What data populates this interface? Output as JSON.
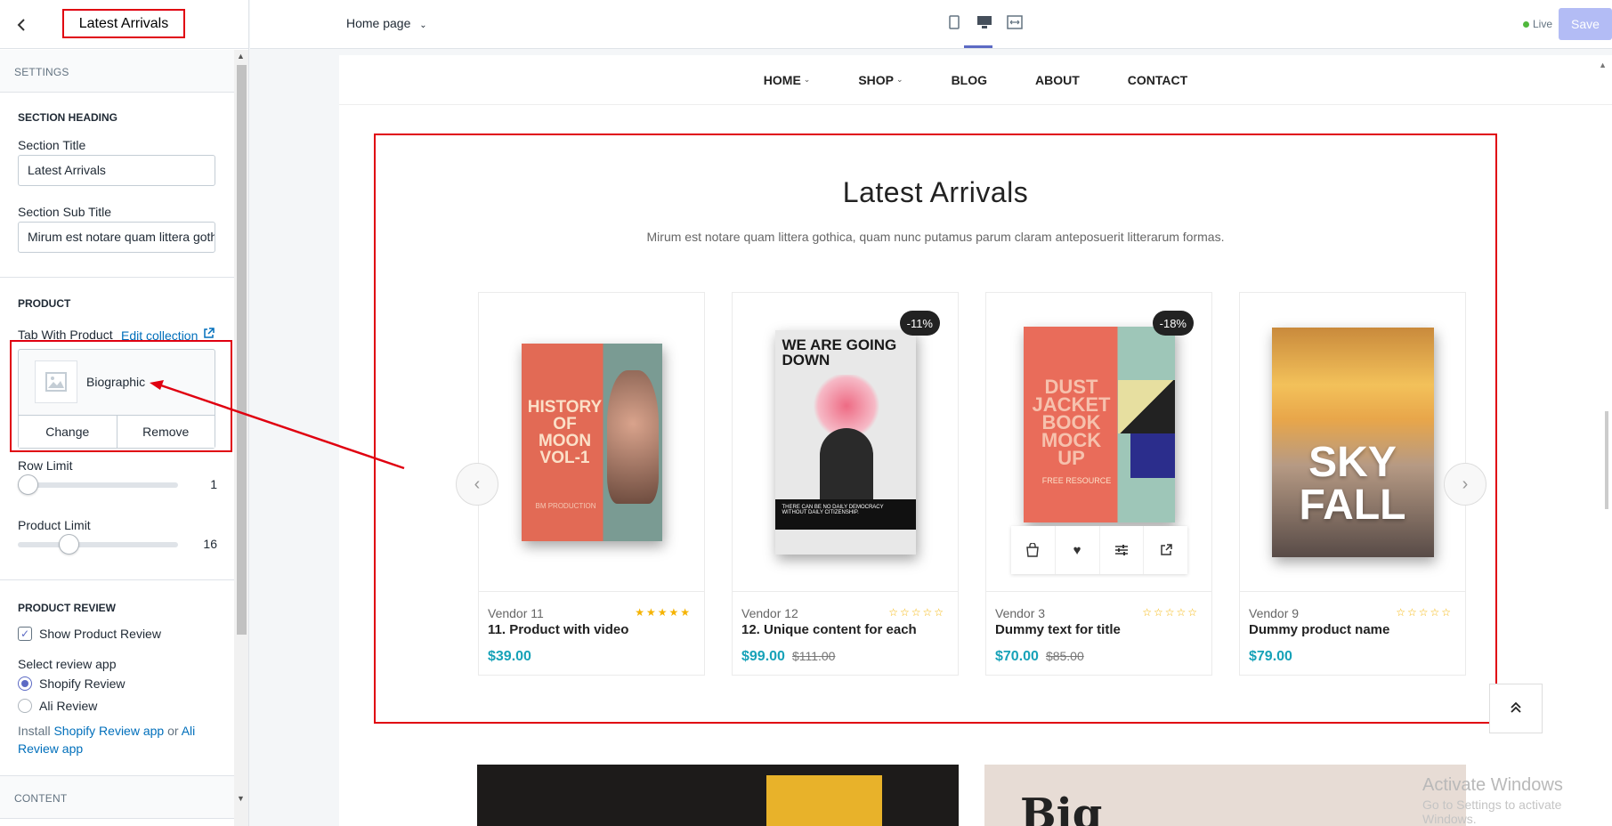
{
  "sidebar": {
    "title": "Latest Arrivals",
    "settings_label": "SETTINGS",
    "section_heading": {
      "heading": "SECTION HEADING",
      "title_label": "Section Title",
      "title_value": "Latest Arrivals",
      "subtitle_label": "Section Sub Title",
      "subtitle_value": "Mirum est notare quam littera gothica"
    },
    "product": {
      "heading": "PRODUCT",
      "tab_label": "Tab With Product",
      "edit_link": "Edit collection",
      "selected_collection": "Biographic",
      "change_label": "Change",
      "remove_label": "Remove",
      "row_limit_label": "Row Limit",
      "row_limit_value": "1",
      "product_limit_label": "Product Limit",
      "product_limit_value": "16"
    },
    "review": {
      "heading": "PRODUCT REVIEW",
      "show_label": "Show Product Review",
      "show_checked": true,
      "select_label": "Select review app",
      "option_shopify": "Shopify Review",
      "option_ali": "Ali Review",
      "install_prefix": "Install",
      "install_link1": "Shopify Review app",
      "install_or": "or",
      "install_link2": "Ali Review app"
    },
    "content_label": "CONTENT"
  },
  "topbar": {
    "page_select": "Home page",
    "live_label": "Live",
    "save_label": "Save"
  },
  "preview": {
    "nav": [
      "HOME",
      "SHOP",
      "BLOG",
      "ABOUT",
      "CONTACT"
    ],
    "section_title": "Latest Arrivals",
    "section_subtitle": "Mirum est notare quam littera gothica, quam nunc putamus parum claram anteposuerit litterarum formas.",
    "products": [
      {
        "vendor": "Vendor 11",
        "name": "11. Product with video",
        "price": "$39.00",
        "old_price": "",
        "badge": "",
        "stars": "★★★★★",
        "book_text": "HISTORY OF MOON VOL-1",
        "book_sub": "BM PRODUCTION"
      },
      {
        "vendor": "Vendor 12",
        "name": "12. Unique content for each",
        "price": "$99.00",
        "old_price": "$111.00",
        "badge": "-11%",
        "stars": "☆☆☆☆☆",
        "book_text": "WE ARE GOING DOWN",
        "book_sub": "THERE CAN BE NO DAILY DEMOCRACY WITHOUT DAILY CITIZENSHIP."
      },
      {
        "vendor": "Vendor 3",
        "name": "Dummy text for title",
        "price": "$70.00",
        "old_price": "$85.00",
        "badge": "-18%",
        "stars": "☆☆☆☆☆",
        "book_text": "DUST JACKET BOOK MOCK UP",
        "book_sub": "FREE RESOURCE"
      },
      {
        "vendor": "Vendor 9",
        "name": "Dummy product name",
        "price": "$79.00",
        "old_price": "",
        "badge": "",
        "stars": "☆☆☆☆☆",
        "book_text": "SKY FALL",
        "book_sub": ""
      }
    ],
    "banner_big_text": "Big",
    "watermark_line1": "Activate Windows",
    "watermark_line2": "Go to Settings to activate Windows."
  },
  "colors": {
    "accent": "#5c6ac4",
    "price": "#17a2b8",
    "highlight": "#e00010",
    "star_filled": "#f5b301"
  }
}
